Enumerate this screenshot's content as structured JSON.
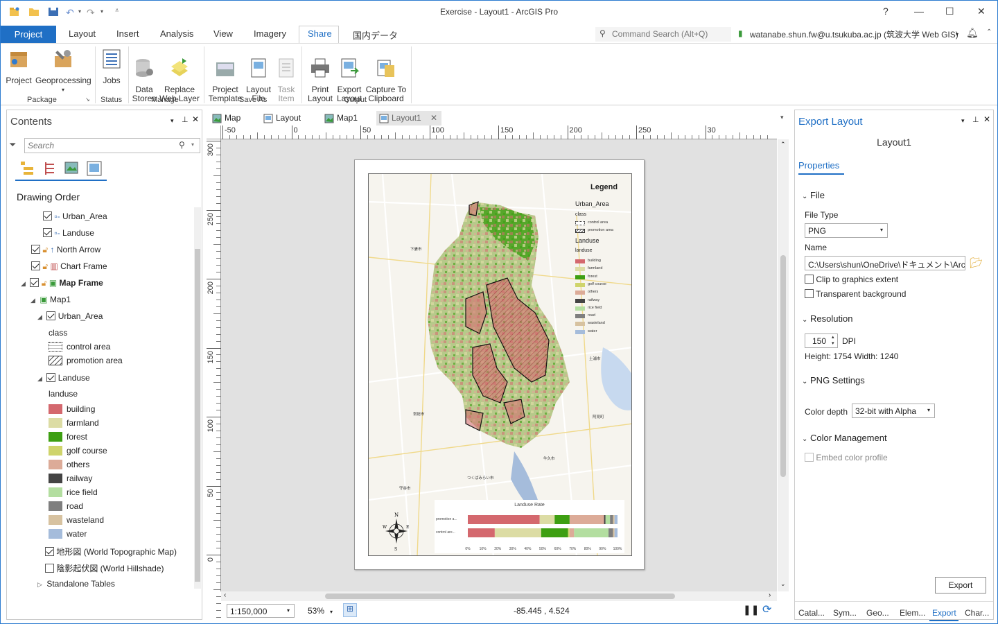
{
  "window": {
    "title": "Exercise - Layout1 - ArcGIS Pro",
    "help": "?"
  },
  "ribbon_tabs": [
    "Project",
    "Layout",
    "Insert",
    "Analysis",
    "View",
    "Imagery",
    "Share",
    "国内データ"
  ],
  "command_search": {
    "placeholder": "Command Search (Alt+Q)"
  },
  "user": {
    "name": "watanabe.shun.fw@u.tsukuba.ac.jp (筑波大学 Web GIS)"
  },
  "ribbon": {
    "buttons": {
      "project": "Project",
      "geoprocessing": "Geoprocessing",
      "jobs": "Jobs",
      "data_stores": "Data\nStores",
      "replace_web_layer": "Replace\nWeb Layer",
      "project_template": "Project\nTemplate",
      "layout_file": "Layout\nFile",
      "task_item": "Task\nItem",
      "print_layout": "Print\nLayout",
      "export_layout": "Export\nLayout",
      "capture_to_clipboard": "Capture To\nClipboard"
    },
    "groups": {
      "package": "Package",
      "status": "Status",
      "manage": "Manage",
      "save_as": "Save As",
      "output": "Output"
    }
  },
  "contents": {
    "title": "Contents",
    "search_placeholder": "Search",
    "drawing_order": "Drawing Order",
    "layers": {
      "urban_area_top": "Urban_Area",
      "landuse_top": "Landuse",
      "north_arrow": "North Arrow",
      "chart_frame": "Chart Frame",
      "map_frame": "Map Frame",
      "map1": "Map1",
      "urban_area": "Urban_Area",
      "class_label": "class",
      "control_area": "control area",
      "promotion_area": "promotion area",
      "landuse": "Landuse",
      "landuse_label": "landuse",
      "topo": "地形図 (World Topographic Map)",
      "hillshade": "陰影起伏図 (World Hillshade)",
      "standalone": "Standalone Tables"
    },
    "landuse_classes": [
      {
        "label": "building",
        "color": "#d4686e"
      },
      {
        "label": "farmland",
        "color": "#dcdca4"
      },
      {
        "label": "forest",
        "color": "#3d9f12"
      },
      {
        "label": "golf course",
        "color": "#cfd46b"
      },
      {
        "label": "others",
        "color": "#dcab98"
      },
      {
        "label": "railway",
        "color": "#444444"
      },
      {
        "label": "rice field",
        "color": "#b3dea0"
      },
      {
        "label": "road",
        "color": "#7f7f7f"
      },
      {
        "label": "wasteland",
        "color": "#d7c2a0"
      },
      {
        "label": "water",
        "color": "#a5bcdb"
      }
    ]
  },
  "doc_tabs": [
    "Map",
    "Layout",
    "Map1",
    "Layout1"
  ],
  "ruler": {
    "h": [
      "-50",
      "0",
      "50",
      "100",
      "150",
      "200",
      "250",
      "30"
    ],
    "v": [
      "300",
      "250",
      "200",
      "150",
      "100",
      "50",
      "0"
    ]
  },
  "layout": {
    "legend_title": "Legend",
    "urban_area": "Urban_Area",
    "class": "class",
    "control_area": "control area",
    "promotion_area": "promotion area",
    "landuse": "Landuse",
    "landuse_field": "landuse",
    "chart_title": "Landuse Rate",
    "chart_rows": [
      "promotion a...",
      "control are..."
    ],
    "chart_ticks": [
      "0%",
      "10%",
      "20%",
      "30%",
      "40%",
      "50%",
      "60%",
      "70%",
      "80%",
      "90%",
      "100%"
    ],
    "north": "N",
    "south": "S",
    "east": "E",
    "west": "W",
    "place_labels": [
      "下妻市",
      "土浦市",
      "阿見町",
      "牛久市",
      "つくばみらい市",
      "常総市",
      "守谷市"
    ]
  },
  "chart_data": {
    "type": "bar",
    "title": "Landuse Rate",
    "categories": [
      "promotion a...",
      "control are..."
    ],
    "series": [
      {
        "name": "building",
        "values": [
          48,
          18
        ]
      },
      {
        "name": "farmland",
        "values": [
          10,
          31
        ]
      },
      {
        "name": "forest",
        "values": [
          10,
          18
        ]
      },
      {
        "name": "golf course",
        "values": [
          0,
          1
        ]
      },
      {
        "name": "others",
        "values": [
          23,
          3
        ]
      },
      {
        "name": "railway",
        "values": [
          1,
          0
        ]
      },
      {
        "name": "rice field",
        "values": [
          3,
          23
        ]
      },
      {
        "name": "road",
        "values": [
          2,
          3
        ]
      },
      {
        "name": "wasteland",
        "values": [
          1,
          1
        ]
      },
      {
        "name": "water",
        "values": [
          2,
          2
        ]
      }
    ],
    "xlim": [
      0,
      100
    ]
  },
  "status": {
    "scale": "1:150,000",
    "zoom": "53%",
    "coords": "-85.445 , 4.524"
  },
  "export_pane": {
    "title": "Export Layout",
    "layout_name": "Layout1",
    "properties": "Properties",
    "file": "File",
    "file_type_label": "File Type",
    "file_type": "PNG",
    "name_label": "Name",
    "name_value": "C:\\Users\\shun\\OneDrive\\ドキュメント\\ArcGIS",
    "clip": "Clip to graphics extent",
    "transparent": "Transparent background",
    "resolution": "Resolution",
    "dpi_value": "150",
    "dpi": "DPI",
    "size": "Height: 1754 Width: 1240",
    "png_settings": "PNG Settings",
    "color_depth_label": "Color depth",
    "color_depth": "32-bit with Alpha",
    "color_management": "Color Management",
    "embed": "Embed color profile",
    "export_button": "Export"
  },
  "bottom_tabs": [
    "Catal...",
    "Sym...",
    "Geo...",
    "Elem...",
    "Export",
    "Char..."
  ]
}
